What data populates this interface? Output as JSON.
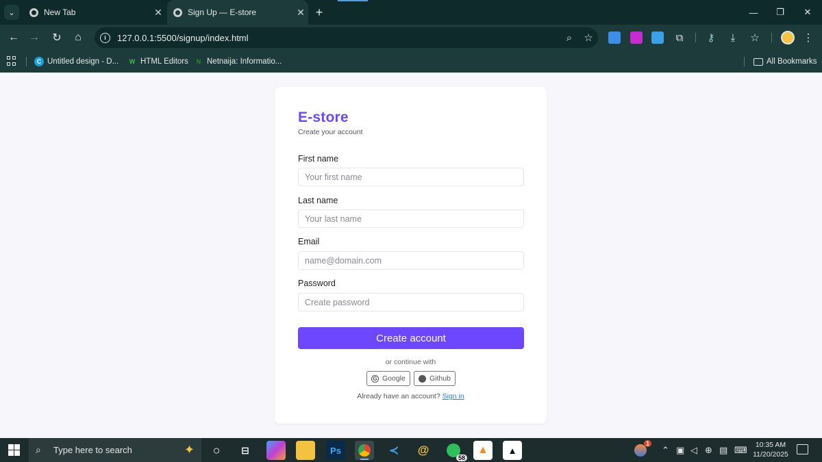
{
  "browser": {
    "tabs": [
      {
        "title": "New Tab",
        "active": false
      },
      {
        "title": "Sign Up — E-store",
        "active": true
      }
    ],
    "url": "127.0.0.1:5500/signup/index.html",
    "bookmarks": [
      {
        "label": "Untitled design - D...",
        "icon": "canva-icon"
      },
      {
        "label": "HTML Editors",
        "icon": "w-logo-icon"
      },
      {
        "label": "Netnaija: Informatio...",
        "icon": "n-logo-icon"
      }
    ],
    "all_bookmarks": "All Bookmarks"
  },
  "signup": {
    "brand": "E-store",
    "subtitle": "Create your account",
    "fields": [
      {
        "label": "First name",
        "placeholder": "Your first name"
      },
      {
        "label": "Last name",
        "placeholder": "Your last name"
      },
      {
        "label": "Email",
        "placeholder": "name@domain.com"
      },
      {
        "label": "Password",
        "placeholder": "Create password"
      }
    ],
    "submit_label": "Create account",
    "divider_text": "or continue with",
    "social": [
      {
        "label": "Google",
        "icon": "google-icon"
      },
      {
        "label": "Github",
        "icon": "github-icon"
      }
    ],
    "signin_prompt": "Already have an account?",
    "signin_link": "Sign in",
    "accent": "#6c47ff"
  },
  "taskbar": {
    "search_placeholder": "Type here to search",
    "whatsapp_badge": "58",
    "notification_badge": "1",
    "time": "10:35 AM",
    "date": "11/20/2025"
  }
}
